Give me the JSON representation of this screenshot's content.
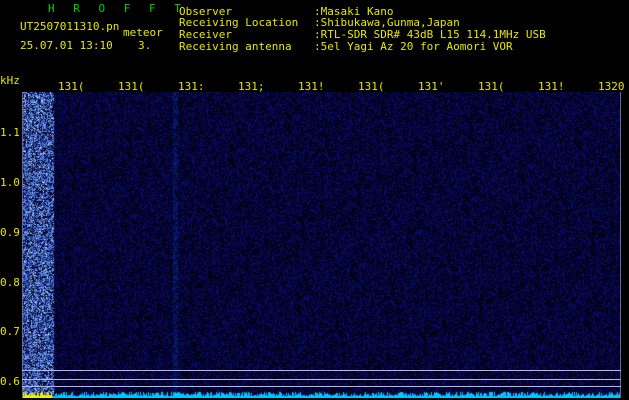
{
  "app": {
    "name": "H R O F F T",
    "filename": "UT2507011310.pn",
    "mode": "meteor",
    "datetime": "25.07.01 13:10",
    "page_indicator": "3."
  },
  "info": {
    "observer_label": "Observer",
    "observer_value": ":Masaki Kano",
    "location_label": "Receiving Location",
    "location_value": ":Shibukawa,Gunma,Japan",
    "receiver_label": "Receiver",
    "receiver_value": ":RTL-SDR SDR# 43dB L15 114.1MHz USB",
    "antenna_label": "Receiving antenna",
    "antenna_value": ":5el Yagi Az 20 for Aomori VOR"
  },
  "axis": {
    "unit": "kHz",
    "y_ticks": [
      "1.1",
      "1.0",
      "0.9",
      "0.8",
      "0.7",
      "0.6"
    ],
    "time_ticks": [
      "131(",
      "131(",
      "131:",
      "131;",
      "131!",
      "131(",
      "131'",
      "131(",
      "131!",
      "1320"
    ]
  },
  "colors": {
    "label_text": "#e8e800",
    "title_text": "#00d200",
    "background": "#000000",
    "noise": "#1a1a8c"
  }
}
